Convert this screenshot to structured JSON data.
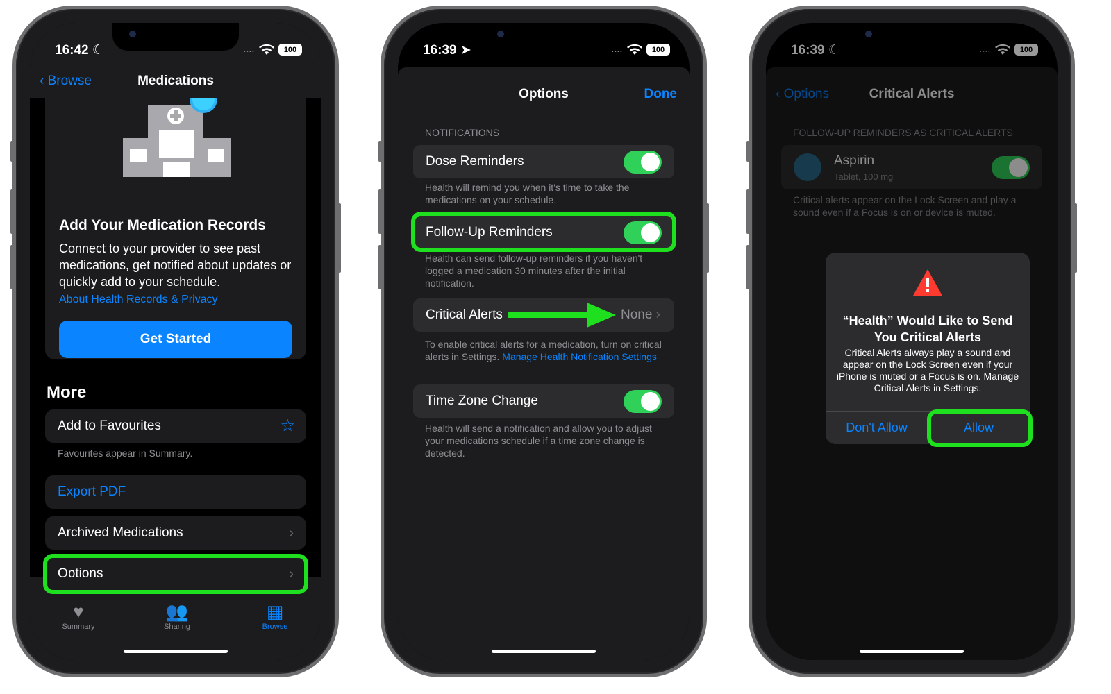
{
  "screen1": {
    "status": {
      "time": "16:42 ☾",
      "battery": "100"
    },
    "nav": {
      "back": "Browse",
      "title": "Medications"
    },
    "card": {
      "title": "Add Your Medication Records",
      "description": "Connect to your provider to see past medications, get notified about updates or quickly add to your schedule.",
      "link": "About Health Records & Privacy",
      "button": "Get Started"
    },
    "more_title": "More",
    "favourites": {
      "label": "Add to Favourites",
      "note": "Favourites appear in Summary."
    },
    "export": "Export PDF",
    "archived": "Archived Medications",
    "options": "Options",
    "tabs": [
      {
        "label": "Summary",
        "icon": "heart-icon"
      },
      {
        "label": "Sharing",
        "icon": "people-icon"
      },
      {
        "label": "Browse",
        "icon": "grid-icon"
      }
    ]
  },
  "screen2": {
    "status": {
      "time": "16:39 ➤",
      "battery": "100"
    },
    "title": "Options",
    "done": "Done",
    "section": "NOTIFICATIONS",
    "dose": {
      "label": "Dose Reminders",
      "on": true,
      "footer": "Health will remind you when it's time to take the medications on your schedule."
    },
    "followup": {
      "label": "Follow-Up Reminders",
      "on": true,
      "footer": "Health can send follow-up reminders if you haven't logged a medication 30 minutes after the initial notification."
    },
    "critical": {
      "label": "Critical Alerts",
      "value": "None",
      "footer_text": "To enable critical alerts for a medication, turn on critical alerts in Settings.",
      "footer_link": "Manage Health Notification Settings"
    },
    "timezone": {
      "label": "Time Zone Change",
      "on": true,
      "footer": "Health will send a notification and allow you to adjust your medications schedule if a time zone change is detected."
    }
  },
  "screen3": {
    "status": {
      "time": "16:39 ☾",
      "battery": "100"
    },
    "back": "Options",
    "title": "Critical Alerts",
    "section": "FOLLOW-UP REMINDERS AS CRITICAL ALERTS",
    "med": {
      "name": "Aspirin",
      "detail": "Tablet, 100 mg"
    },
    "footer": "Critical alerts appear on the Lock Screen and play a sound even if a Focus is on or device is muted.",
    "alert": {
      "title": "“Health” Would Like to Send You Critical Alerts",
      "message": "Critical Alerts always play a sound and appear on the Lock Screen even if your iPhone is muted or a Focus is on. Manage Critical Alerts in Settings.",
      "deny": "Don't Allow",
      "allow": "Allow"
    }
  },
  "colors": {
    "accent": "#0a84ff",
    "highlight": "#1fe01f",
    "toggle_on": "#30d158",
    "warning": "#ff3b30"
  }
}
